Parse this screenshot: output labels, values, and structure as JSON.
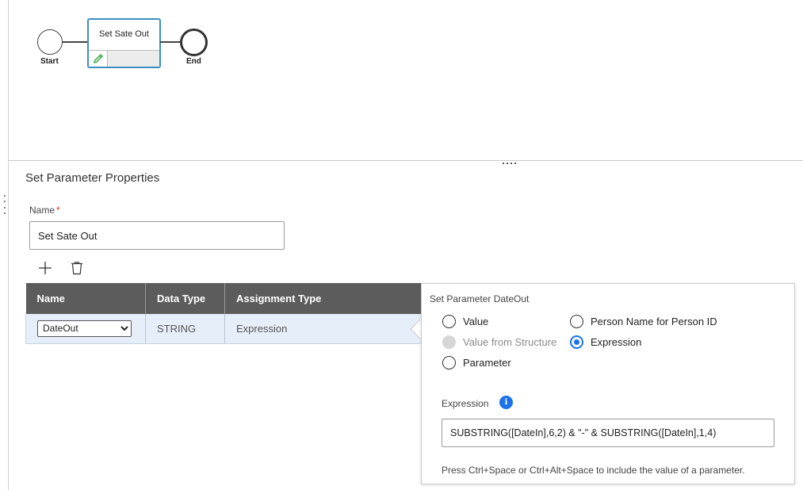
{
  "diagram": {
    "start_label": "Start",
    "end_label": "End",
    "task_title": "Set Sate Out",
    "icons": {
      "edit": "pencil-icon"
    }
  },
  "properties": {
    "title": "Set Parameter Properties",
    "name_label": "Name",
    "required_marker": "*",
    "name_value": "Set Sate Out",
    "toolbar": {
      "add_icon": "plus-icon",
      "delete_icon": "trash-icon"
    },
    "table": {
      "headers": [
        "Name",
        "Data Type",
        "Assignment Type"
      ],
      "rows": [
        {
          "name": "DateOut",
          "data_type": "STRING",
          "assignment_type": "Expression"
        }
      ]
    }
  },
  "popover": {
    "title": "Set Parameter DateOut",
    "options": {
      "value": "Value",
      "value_from_structure": "Value from Structure",
      "parameter": "Parameter",
      "person_name": "Person Name for Person ID",
      "expression": "Expression"
    },
    "selected": "Expression",
    "expression_label": "Expression",
    "info_icon": "info-icon",
    "expression_value": "SUBSTRING([DateIn],6,2) & \"-\" & SUBSTRING([DateIn],1,4)",
    "hint": "Press Ctrl+Space or Ctrl+Alt+Space to include the value of a parameter."
  },
  "colors": {
    "accent": "#1a73e8",
    "task_border": "#3b8fbf",
    "header_bg": "#5c5c5c",
    "row_selected_bg": "#e6eef9",
    "required": "#d93025"
  }
}
